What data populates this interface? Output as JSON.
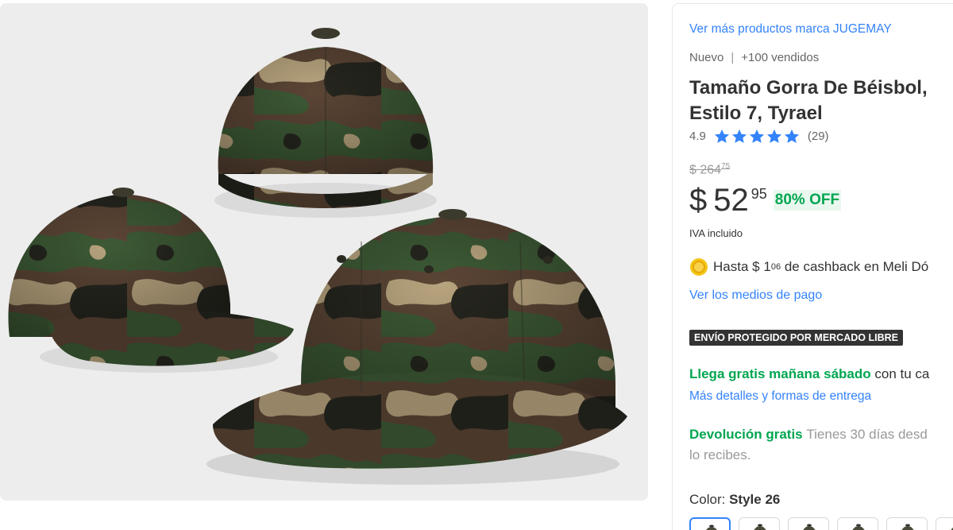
{
  "gallery": {
    "image_alt": "Gorras de béisbol camufladas"
  },
  "product": {
    "brand_link": "Ver más productos marca JUGEMAY",
    "condition": "Nuevo",
    "sold": "+100 vendidos",
    "title": "Tamaño Gorra De Béisbol, Estilo 7, Tyrael",
    "rating": "4.9",
    "rating_count": "(29)",
    "stars": 5
  },
  "price": {
    "old_currency": "$",
    "old_int": "264",
    "old_cents": "75",
    "currency": "$",
    "int": "52",
    "cents": "95",
    "discount": "80% OFF",
    "tax_note": "IVA incluido"
  },
  "cashback": {
    "prefix": "Hasta",
    "currency": "$",
    "int": "1",
    "cents": "06",
    "suffix": "de cashback en Meli Dó"
  },
  "payment": {
    "link": "Ver los medios de pago"
  },
  "shipping": {
    "badge": "ENVÍO PROTEGIDO POR MERCADO LIBRE",
    "highlight": "Llega gratis mañana sábado",
    "rest": "con tu ca",
    "details_link": "Más detalles y formas de entrega"
  },
  "returns": {
    "highlight": "Devolución gratis",
    "text": "Tienes 30 días desd",
    "text2": "lo recibes."
  },
  "variant": {
    "label": "Color:",
    "value": "Style 26",
    "swatch_count": 6
  },
  "colors": {
    "link": "#3483fa",
    "green": "#00a650",
    "star": "#3483fa",
    "badge_bg": "#333333"
  }
}
